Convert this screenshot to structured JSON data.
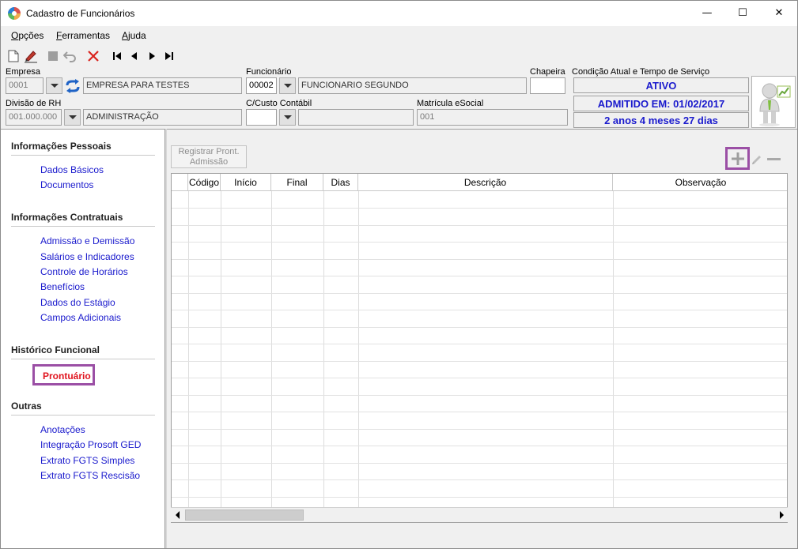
{
  "window": {
    "title": "Cadastro de Funcionários",
    "minimize_symbol": "—",
    "maximize_symbol": "☐",
    "close_symbol": "✕"
  },
  "menu": {
    "items": [
      {
        "first": "O",
        "rest": "pções"
      },
      {
        "first": "F",
        "rest": "erramentas"
      },
      {
        "first": "A",
        "rest": "juda"
      }
    ]
  },
  "toolbar": {
    "icons": [
      "new-document-icon",
      "edit-icon",
      "save-icon",
      "undo-icon",
      "delete-icon",
      "first-record-icon",
      "previous-record-icon",
      "next-record-icon",
      "last-record-icon"
    ]
  },
  "header": {
    "empresa_label": "Empresa",
    "empresa_code": "0001",
    "empresa_name": "EMPRESA PARA TESTES",
    "funcionario_label": "Funcionário",
    "funcionario_code": "00002",
    "funcionario_name": "FUNCIONARIO SEGUNDO",
    "chapeira_label": "Chapeira",
    "chapeira_value": "",
    "condicao_label": "Condição Atual e Tempo de Serviço",
    "status": "ATIVO",
    "admitido": "ADMITIDO EM: 01/02/2017",
    "tempo_servico": "2 anos 4 meses 27 dias",
    "divisao_label": "Divisão de RH",
    "divisao_code": "001.000.000",
    "divisao_name": "ADMINISTRAÇÃO",
    "custo_label": "C/Custo Contábil",
    "custo_code": "",
    "custo_name": "",
    "matricula_label": "Matrícula eSocial",
    "matricula_value": "001",
    "status_color": "#1a1acd"
  },
  "sidebar": {
    "sections": [
      {
        "title": "Informações Pessoais",
        "items": [
          "Dados Básicos",
          "Documentos"
        ]
      },
      {
        "title": "Informações Contratuais",
        "items": [
          "Admissão e Demissão",
          "Salários e Indicadores",
          "Controle de Horários",
          "Benefícios",
          "Dados do Estágio",
          "Campos Adicionais"
        ]
      },
      {
        "title": "Histórico Funcional",
        "items": [
          "Prontuário"
        ]
      },
      {
        "title": "Outras",
        "items": [
          "Anotações",
          "Integração Prosoft GED",
          "Extrato FGTS Simples",
          "Extrato FGTS Rescisão"
        ]
      }
    ],
    "active_item": "Prontuário",
    "link_color": "#1a1acd",
    "active_color": "#e0141e",
    "highlight_color": "#9b4fa5"
  },
  "main": {
    "register_button_line1": "Registrar Pront.",
    "register_button_line2": "Admissão",
    "grid_columns": [
      "",
      "Código",
      "Início",
      "Final",
      "Dias",
      "Descrição",
      "Observação"
    ],
    "rows": []
  }
}
